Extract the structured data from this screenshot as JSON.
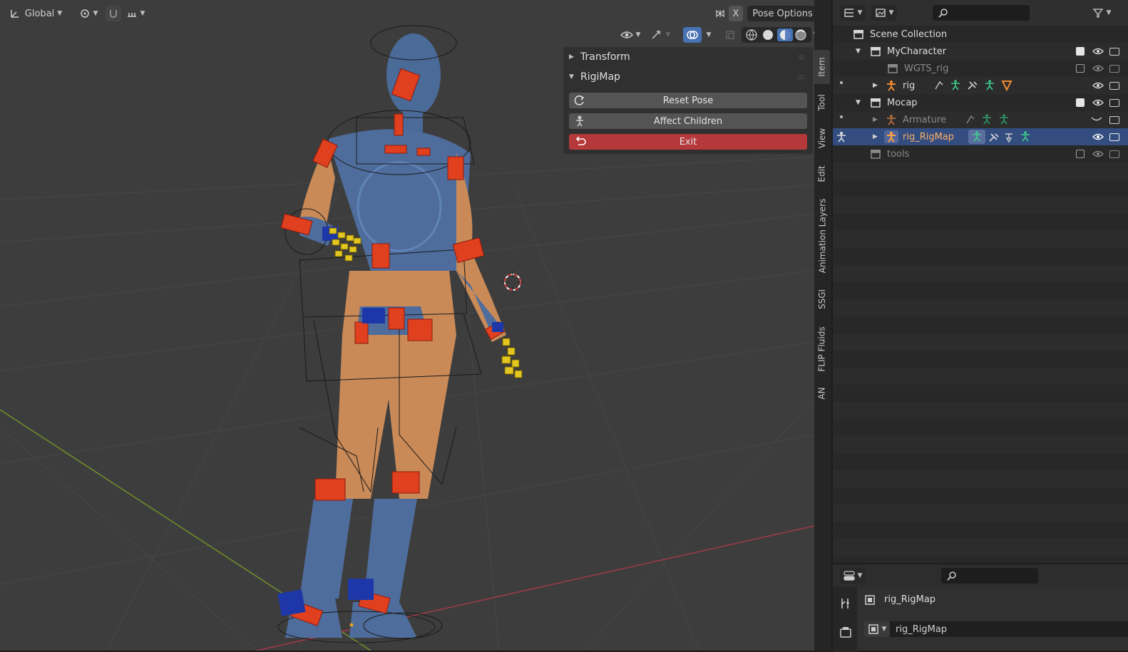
{
  "viewport_header": {
    "orientation": "Global",
    "pose_options": "Pose Options",
    "x_mirror": "X"
  },
  "rigimap_panel": {
    "transform_label": "Transform",
    "rigimap_label": "RigiMap",
    "reset_pose": "Reset Pose",
    "affect_children": "Affect Children",
    "exit": "Exit"
  },
  "sidebar_tabs": [
    "Item",
    "Tool",
    "View",
    "Edit",
    "Animation Layers",
    "SSGI",
    "FLIP Fluids",
    "AN"
  ],
  "outliner": {
    "search_placeholder": "",
    "rows": [
      {
        "label": "Scene Collection"
      },
      {
        "label": "MyCharacter"
      },
      {
        "label": "WGTS_rig"
      },
      {
        "label": "rig"
      },
      {
        "label": "Mocap"
      },
      {
        "label": "Armature"
      },
      {
        "label": "rig_RigMap"
      },
      {
        "label": "tools"
      }
    ]
  },
  "properties": {
    "object_name": "rig_RigMap",
    "object_field": "rig_RigMap"
  },
  "colors": {
    "accent": "#4772b3",
    "exit_red": "#b5383a",
    "selected_row": "#334d80",
    "bone_orange": "#ffb062"
  }
}
